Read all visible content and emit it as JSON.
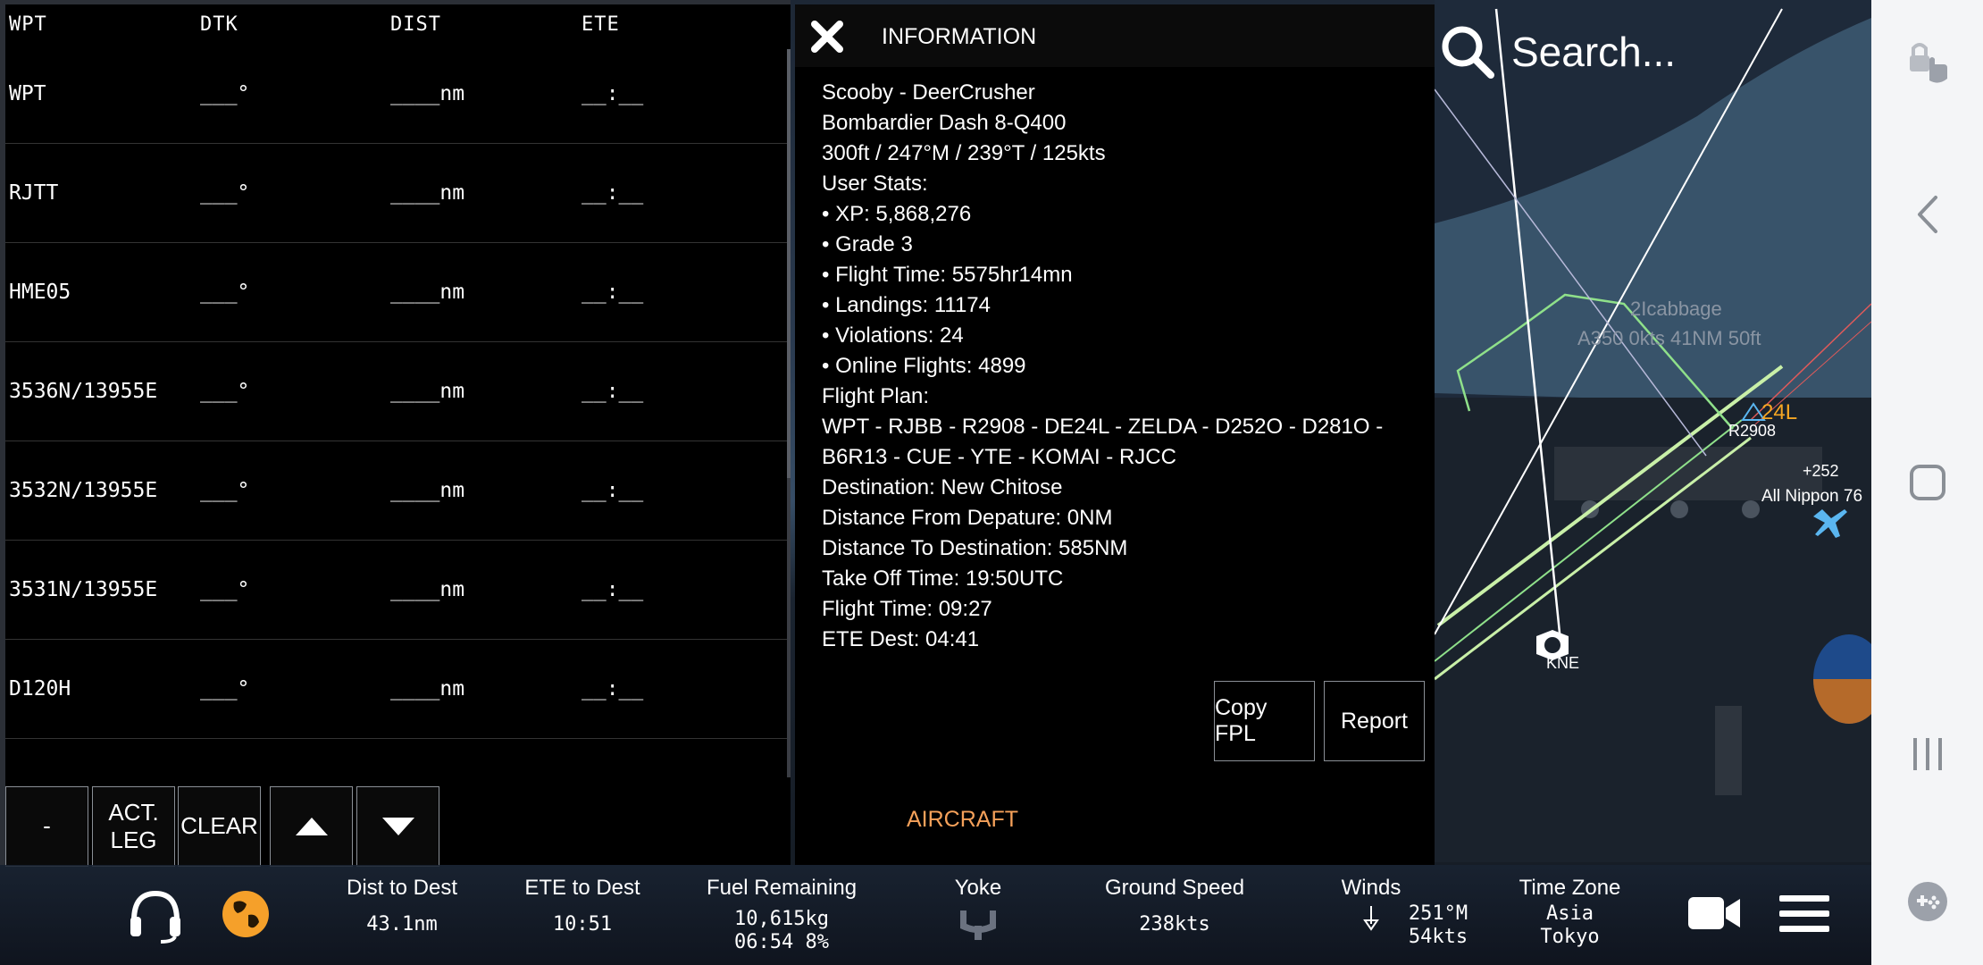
{
  "fpl": {
    "headers": [
      "WPT",
      "DTK",
      "DIST",
      "ETE"
    ],
    "rows": [
      {
        "wpt": "WPT",
        "dtk": "___°",
        "dist": "____nm",
        "ete": "__:__"
      },
      {
        "wpt": "RJTT",
        "dtk": "___°",
        "dist": "____nm",
        "ete": "__:__"
      },
      {
        "wpt": "HME05",
        "dtk": "___°",
        "dist": "____nm",
        "ete": "__:__"
      },
      {
        "wpt": "3536N/13955E",
        "dtk": "___°",
        "dist": "____nm",
        "ete": "__:__"
      },
      {
        "wpt": "3532N/13955E",
        "dtk": "___°",
        "dist": "____nm",
        "ete": "__:__"
      },
      {
        "wpt": "3531N/13955E",
        "dtk": "___°",
        "dist": "____nm",
        "ete": "__:__"
      },
      {
        "wpt": "D120H",
        "dtk": "___°",
        "dist": "____nm",
        "ete": "__:__"
      }
    ],
    "buttons": {
      "minus": "-",
      "act_leg_1": "ACT.",
      "act_leg_2": "LEG",
      "clear": "CLEAR"
    }
  },
  "info": {
    "title": "INFORMATION",
    "lines": [
      "Scooby - DeerCrusher",
      "Bombardier Dash 8-Q400",
      "300ft / 247°M / 239°T / 125kts",
      "User Stats:",
      "• XP: 5,868,276",
      "•  Grade 3",
      "•  Flight Time: 5575hr14mn",
      "•  Landings: 11174",
      "• Violations: 24",
      "•  Online Flights: 4899",
      "Flight Plan:"
    ],
    "flight_plan": "WPT - RJBB - R2908 - DE24L - ZELDA - D252O - D281O - B6R13 - CUE - YTE - KOMAI - RJCC",
    "lines_after": [
      "Destination: New Chitose",
      "Distance From Depature: 0NM",
      "Distance To Destination: 585NM",
      "Take Off Time: 19:50UTC",
      "Flight Time: 09:27",
      "ETE Dest: 04:41"
    ],
    "copy_fpl": "Copy FPL",
    "report": "Report",
    "aircraft_tab": "AIRCRAFT"
  },
  "map": {
    "search_placeholder": "Search...",
    "labels": {
      "other_user": "2Icabbage",
      "other_user_info": "A350 0kts 41NM 50ft",
      "runway": "24L",
      "waypoint_r2908": "R2908",
      "vs_readout": "+252",
      "traffic": "All Nippon 76",
      "vor": "KNE"
    },
    "route_color": "#8fe08a",
    "traffic_color": "#5ab6f0",
    "runway_color": "#f5a623"
  },
  "status": {
    "dist_to_dest": {
      "label": "Dist to Dest",
      "value": "43.1nm"
    },
    "ete_to_dest": {
      "label": "ETE to Dest",
      "value": "10:51"
    },
    "fuel": {
      "label": "Fuel Remaining",
      "value1": "10,615kg",
      "value2": "06:54 8%"
    },
    "yoke": {
      "label": "Yoke"
    },
    "ground_speed": {
      "label": "Ground Speed",
      "value": "238kts"
    },
    "winds": {
      "label": "Winds",
      "value1": "251°M",
      "value2": "54kts"
    },
    "time_zone": {
      "label": "Time Zone",
      "value1": "Asia",
      "value2": "Tokyo"
    },
    "globe_color": "#f5a02a"
  }
}
